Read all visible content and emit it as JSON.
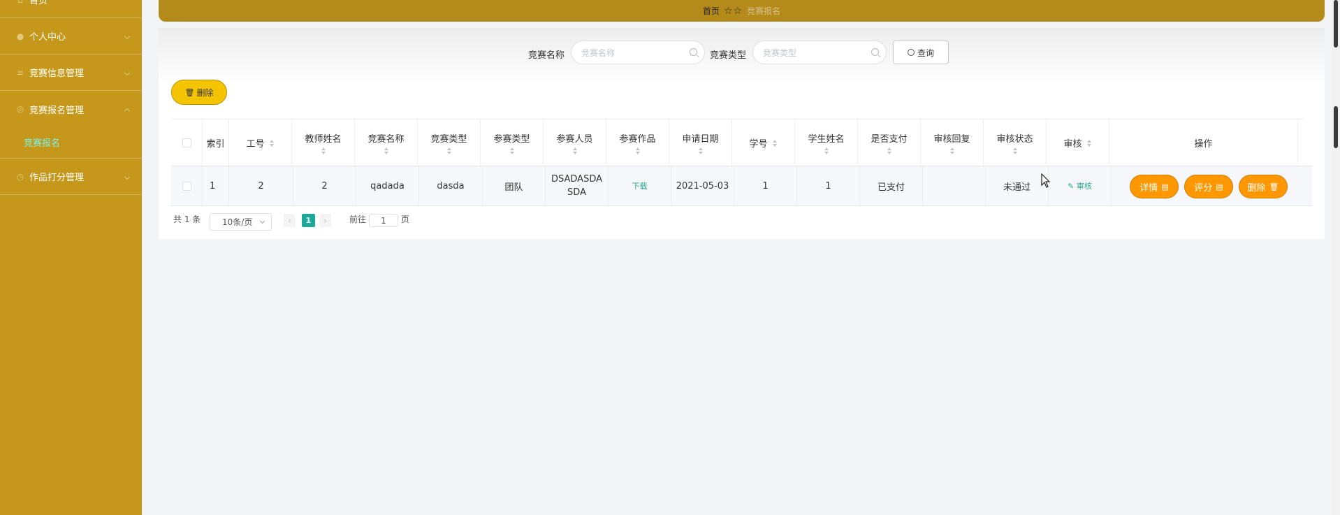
{
  "sidebar": {
    "items": [
      {
        "label": "首页",
        "icon": "home-icon"
      },
      {
        "label": "个人中心",
        "icon": "user-icon"
      },
      {
        "label": "竞赛信息管理",
        "icon": "list-icon"
      },
      {
        "label": "竞赛报名管理",
        "icon": "settings-icon"
      },
      {
        "label": "作品打分管理",
        "icon": "clock-icon"
      }
    ],
    "sub_item": "竞赛报名"
  },
  "breadcrumb": {
    "home": "首页",
    "current": "竞赛报名"
  },
  "search": {
    "name_label": "竞赛名称",
    "name_placeholder": "竞赛名称",
    "type_label": "竞赛类型",
    "type_placeholder": "竞赛类型",
    "query_label": "查询"
  },
  "toolbar": {
    "delete_label": "删除"
  },
  "table": {
    "headers": [
      "索引",
      "工号",
      "教师姓名",
      "竞赛名称",
      "竞赛类型",
      "参赛类型",
      "参赛人员",
      "参赛作品",
      "申请日期",
      "学号",
      "学生姓名",
      "是否支付",
      "审核回复",
      "审核状态",
      "审核",
      "操作"
    ],
    "rows": [
      {
        "index": "1",
        "job_no": "2",
        "teacher": "2",
        "comp_name": "qadada",
        "comp_type": "dasda",
        "entry_type": "团队",
        "members_line1": "DSADASDA",
        "members_line2": "SDA",
        "work": "下载",
        "date": "2021-05-03",
        "student_no": "1",
        "student_name": "1",
        "paid": "已支付",
        "reply": "",
        "status": "未通过",
        "audit": "审核",
        "actions": {
          "detail": "详情",
          "score": "评分",
          "delete": "删除"
        }
      }
    ]
  },
  "pagination": {
    "total": "共 1 条",
    "page_size": "10条/页",
    "current_page": "1",
    "goto_prefix": "前往",
    "goto_value": "1",
    "goto_suffix": "页"
  },
  "colors": {
    "sidebar": "#c5981b",
    "topbar": "#b48b1a",
    "accent": "#1aa89a",
    "action": "#ff9800",
    "delete_btn": "#f5c400"
  }
}
